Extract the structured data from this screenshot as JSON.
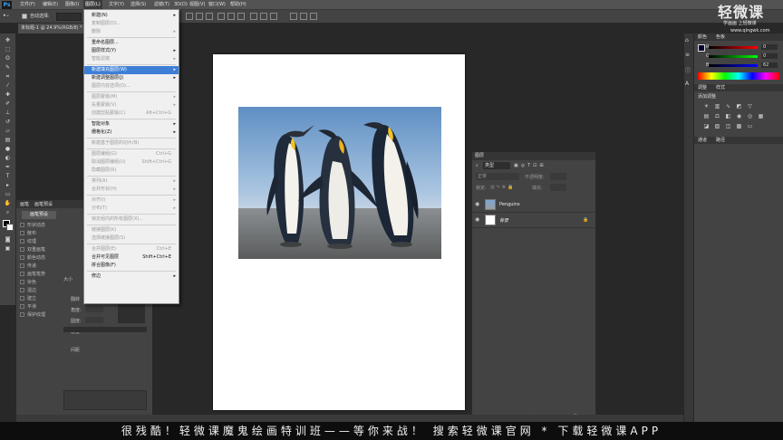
{
  "app": {
    "logo": "Ps"
  },
  "menubar": [
    {
      "label": "文件(F)"
    },
    {
      "label": "编辑(E)"
    },
    {
      "label": "图像(I)"
    },
    {
      "label": "图层(L)",
      "active": true
    },
    {
      "label": "文字(Y)"
    },
    {
      "label": "选择(S)"
    },
    {
      "label": "滤镜(T)"
    },
    {
      "label": "3D(D)"
    },
    {
      "label": "视图(V)"
    },
    {
      "label": "窗口(W)"
    },
    {
      "label": "帮助(H)"
    }
  ],
  "options": {
    "auto_select": "自动选择:"
  },
  "document": {
    "tab_title": "未标题-1 @ 24.9%(RGB/8) *",
    "zoom": "24.9%"
  },
  "layer_menu": {
    "items": [
      {
        "label": "新建(N)",
        "arrow": true
      },
      {
        "label": "复制图层(D)...",
        "disabled": true
      },
      {
        "label": "删除",
        "arrow": true,
        "disabled": true
      },
      {
        "sep": true
      },
      {
        "label": "重命名图层..."
      },
      {
        "label": "图层样式(Y)",
        "arrow": true
      },
      {
        "label": "智能滤镜",
        "arrow": true,
        "disabled": true
      },
      {
        "sep": true
      },
      {
        "label": "新建填充图层(W)",
        "arrow": true,
        "highlight": true
      },
      {
        "label": "新建调整图层(J)",
        "arrow": true
      },
      {
        "label": "图层内容选项(O)...",
        "disabled": true
      },
      {
        "sep": true
      },
      {
        "label": "图层蒙版(M)",
        "arrow": true,
        "disabled": true
      },
      {
        "label": "矢量蒙版(V)",
        "arrow": true,
        "disabled": true
      },
      {
        "label": "创建剪贴蒙版(C)",
        "shortcut": "Alt+Ctrl+G",
        "disabled": true
      },
      {
        "sep": true
      },
      {
        "label": "智能对象",
        "arrow": true
      },
      {
        "label": "栅格化(Z)",
        "arrow": true
      },
      {
        "sep": true
      },
      {
        "label": "新建基于图层的切片(B)",
        "disabled": true
      },
      {
        "sep": true
      },
      {
        "label": "图层编组(G)",
        "shortcut": "Ctrl+G",
        "disabled": true
      },
      {
        "label": "取消图层编组(U)",
        "shortcut": "Shift+Ctrl+G",
        "disabled": true
      },
      {
        "label": "隐藏图层(R)",
        "disabled": true
      },
      {
        "sep": true
      },
      {
        "label": "排列(A)",
        "arrow": true,
        "disabled": true
      },
      {
        "label": "合并形状(H)",
        "arrow": true,
        "disabled": true
      },
      {
        "sep": true
      },
      {
        "label": "对齐(I)",
        "arrow": true,
        "disabled": true
      },
      {
        "label": "分布(T)",
        "arrow": true,
        "disabled": true
      },
      {
        "sep": true
      },
      {
        "label": "锁定组内的所有图层(X)...",
        "disabled": true
      },
      {
        "sep": true
      },
      {
        "label": "链接图层(K)",
        "disabled": true
      },
      {
        "label": "选择链接图层(S)",
        "disabled": true
      },
      {
        "sep": true
      },
      {
        "label": "合并图层(E)",
        "shortcut": "Ctrl+E",
        "disabled": true
      },
      {
        "label": "合并可见图层",
        "shortcut": "Shift+Ctrl+E"
      },
      {
        "label": "拼合图像(F)"
      },
      {
        "sep": true
      },
      {
        "label": "修边",
        "arrow": true
      }
    ]
  },
  "left_panel": {
    "tabs": [
      "画笔",
      "画笔预设"
    ],
    "preset_button": "画笔预设",
    "options": [
      "形状动态",
      "散布",
      "纹理",
      "双重画笔",
      "颜色动态",
      "传递",
      "画笔笔势",
      "杂色",
      "湿边",
      "建立",
      "平滑",
      "保护纹理"
    ],
    "size_label": "大小",
    "labels": [
      "翻转",
      "角度:",
      "圆度:",
      "硬度",
      "间距"
    ]
  },
  "color_panel": {
    "tabs": [
      "颜色",
      "色板"
    ],
    "rows": [
      {
        "label": "R",
        "value": "0"
      },
      {
        "label": "G",
        "value": "0"
      },
      {
        "label": "B",
        "value": "62"
      }
    ]
  },
  "adjust_panel": {
    "tabs": [
      "调整",
      "样式"
    ],
    "title": "添加调整"
  },
  "path_panel": {
    "tabs": [
      "通道",
      "路径"
    ]
  },
  "layers_panel": {
    "title": "图层",
    "filter": "类型",
    "blend_mode": "正常",
    "opacity_label": "不透明度:",
    "lock_label": "锁定:",
    "fill_label": "填充:",
    "layers": [
      {
        "name": "Penguins",
        "visible": true
      },
      {
        "name": "背景",
        "visible": true,
        "locked": true
      }
    ]
  },
  "watermark": {
    "brand": "轻微课",
    "slogan": "学画画 上轻微课",
    "url": "www.qingwk.com"
  },
  "ticker": "很残酷！轻微课魔鬼绘画特训班——等你来战！ 搜索轻微课官网 * 下载轻微课APP"
}
